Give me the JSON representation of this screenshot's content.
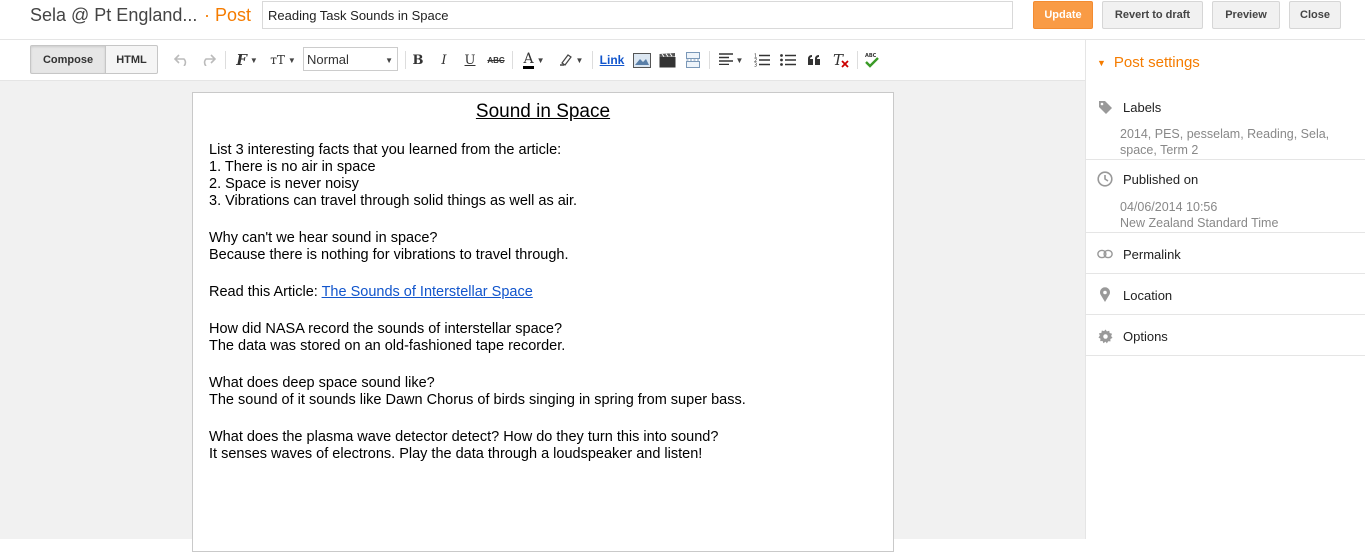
{
  "header": {
    "blog_name": "Sela @ Pt England...",
    "separator": "·",
    "post_label": "Post",
    "title_value": "Reading Task Sounds in Space",
    "buttons": {
      "update": "Update",
      "revert": "Revert to draft",
      "preview": "Preview",
      "close": "Close"
    }
  },
  "toolbar": {
    "compose": "Compose",
    "html": "HTML",
    "font_size": "Normal",
    "bold": "B",
    "italic": "I",
    "underline": "U",
    "strike": "ABC",
    "link": "Link",
    "icons": [
      "undo-icon",
      "redo-icon",
      "font-icon",
      "text-size-icon",
      "text-color-icon",
      "highlight-icon",
      "image-icon",
      "video-icon",
      "jump-break-icon",
      "align-icon",
      "numbered-list-icon",
      "bullet-list-icon",
      "quote-icon",
      "clear-format-icon",
      "spellcheck-icon"
    ]
  },
  "document": {
    "title": "Sound in Space",
    "facts_intro": "List 3 interesting facts that you learned from the article:",
    "fact_1": "1. There is no air in space",
    "fact_2": "2.  Space is never noisy",
    "fact_3": "3.  Vibrations can travel through solid things as well as air.",
    "q1": "Why can't we hear sound in space?",
    "a1": "Because there is nothing for vibrations to travel through.",
    "read_prefix": "Read this Article: ",
    "read_link": "The Sounds of Interstellar Space ",
    "q2": "How did NASA record the sounds of interstellar space?",
    "a2": "The data was stored on an old-fashioned tape recorder.",
    "q3": "What does deep space sound like?",
    "a3": "The sound of it sounds like Dawn Chorus of birds singing in spring from super bass.",
    "q4": "What does the plasma wave detector detect? How do they turn this into sound?",
    "a4": "It senses waves of electrons. Play the data through a loudspeaker and listen!"
  },
  "sidebar": {
    "heading": "Post settings",
    "labels": {
      "title": "Labels",
      "value": "2014, PES, pesselam, Reading, Sela, space, Term 2"
    },
    "published": {
      "title": "Published on",
      "date": "04/06/2014 10:56",
      "timezone": "New Zealand Standard Time"
    },
    "permalink": "Permalink",
    "location": "Location",
    "options": "Options"
  },
  "colors": {
    "accent": "#f57c00",
    "update_button": "#f99b45",
    "link": "#1155cc"
  }
}
